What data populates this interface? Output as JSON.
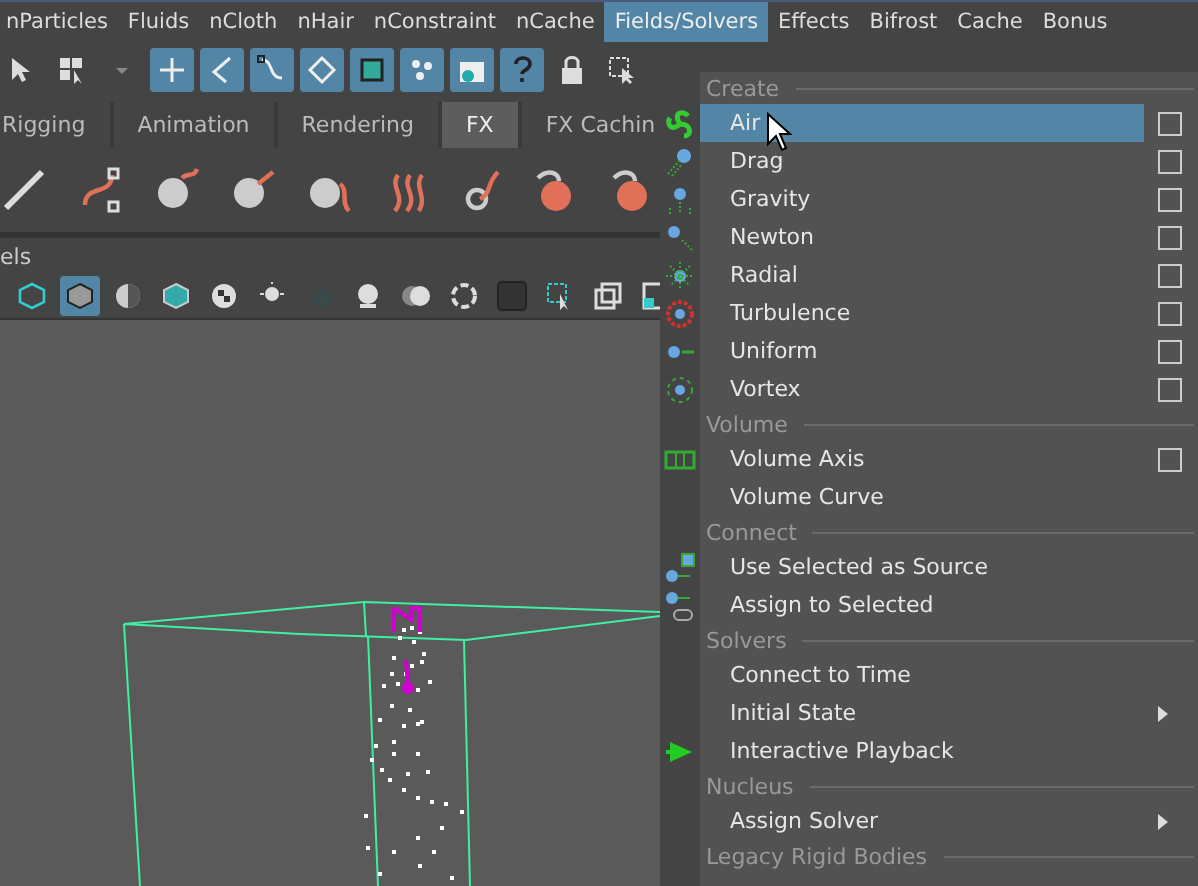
{
  "menu_bar": [
    {
      "label": "nParticles",
      "selected": false
    },
    {
      "label": "Fluids",
      "selected": false
    },
    {
      "label": "nCloth",
      "selected": false
    },
    {
      "label": "nHair",
      "selected": false
    },
    {
      "label": "nConstraint",
      "selected": false
    },
    {
      "label": "nCache",
      "selected": false
    },
    {
      "label": "Fields/Solvers",
      "selected": true
    },
    {
      "label": "Effects",
      "selected": false
    },
    {
      "label": "Bifrost",
      "selected": false
    },
    {
      "label": "Cache",
      "selected": false
    },
    {
      "label": "Bonus",
      "selected": false
    }
  ],
  "shelf_tabs": [
    {
      "label": "Rigging",
      "selected": false
    },
    {
      "label": "Animation",
      "selected": false
    },
    {
      "label": "Rendering",
      "selected": false
    },
    {
      "label": "FX",
      "selected": true
    },
    {
      "label": "FX Cachin",
      "selected": false
    }
  ],
  "panel_label": "els",
  "dropdown": {
    "sections": [
      {
        "title": "Create",
        "items": [
          {
            "label": "Air",
            "option_box": true,
            "submenu": false,
            "selected": true
          },
          {
            "label": "Drag",
            "option_box": true,
            "submenu": false,
            "selected": false
          },
          {
            "label": "Gravity",
            "option_box": true,
            "submenu": false,
            "selected": false
          },
          {
            "label": "Newton",
            "option_box": true,
            "submenu": false,
            "selected": false
          },
          {
            "label": "Radial",
            "option_box": true,
            "submenu": false,
            "selected": false
          },
          {
            "label": "Turbulence",
            "option_box": true,
            "submenu": false,
            "selected": false
          },
          {
            "label": "Uniform",
            "option_box": true,
            "submenu": false,
            "selected": false
          },
          {
            "label": "Vortex",
            "option_box": true,
            "submenu": false,
            "selected": false
          }
        ]
      },
      {
        "title": "Volume",
        "items": [
          {
            "label": "Volume Axis",
            "option_box": true,
            "submenu": false,
            "selected": false
          },
          {
            "label": "Volume Curve",
            "option_box": false,
            "submenu": false,
            "selected": false
          }
        ]
      },
      {
        "title": "Connect",
        "items": [
          {
            "label": "Use Selected as Source",
            "option_box": false,
            "submenu": false,
            "selected": false
          },
          {
            "label": "Assign to Selected",
            "option_box": false,
            "submenu": false,
            "selected": false
          }
        ]
      },
      {
        "title": "Solvers",
        "items": [
          {
            "label": "Connect to Time",
            "option_box": false,
            "submenu": false,
            "selected": false
          },
          {
            "label": "Initial State",
            "option_box": false,
            "submenu": true,
            "selected": false
          },
          {
            "label": "Interactive Playback",
            "option_box": false,
            "submenu": false,
            "selected": false
          }
        ]
      },
      {
        "title": "Nucleus",
        "items": [
          {
            "label": "Assign Solver",
            "option_box": false,
            "submenu": true,
            "selected": false
          }
        ]
      },
      {
        "title": "Legacy Rigid Bodies"
      }
    ]
  }
}
